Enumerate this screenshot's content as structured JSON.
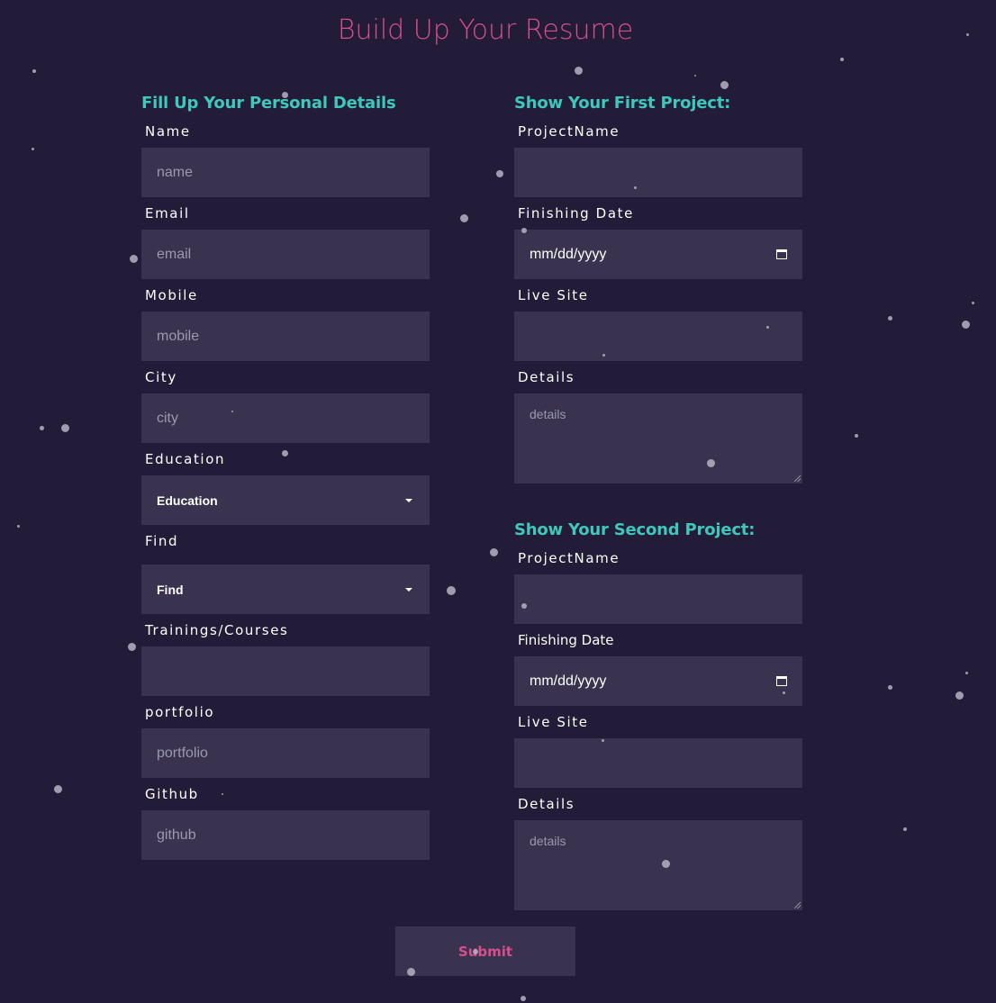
{
  "title": "Build Up Your Resume",
  "personal": {
    "heading": "Fill Up Your Personal Details",
    "name_label": "Name",
    "name_placeholder": "name",
    "email_label": "Email",
    "email_placeholder": "email",
    "mobile_label": "Mobile",
    "mobile_placeholder": "mobile",
    "city_label": "City",
    "city_placeholder": "city",
    "education_label": "Education",
    "education_value": "Education",
    "find_label": "Find",
    "find_value": "Find",
    "trainings_label": "Trainings/Courses",
    "trainings_placeholder": "",
    "portfolio_label": "portfolio",
    "portfolio_placeholder": "portfolio",
    "github_label": "Github",
    "github_placeholder": "github"
  },
  "project1": {
    "heading": "Show Your First Project:",
    "name_label": "ProjectName",
    "date_label": "Finishing Date",
    "date_placeholder": "mm/dd/yyyy",
    "live_label": "Live Site",
    "details_label": "Details",
    "details_placeholder": "details"
  },
  "project2": {
    "heading": "Show Your Second Project:",
    "name_label": "ProjectName",
    "date_label": "Finishing Date",
    "date_placeholder": "mm/dd/yyyy",
    "live_label": "Live Site",
    "details_label": "Details",
    "details_placeholder": "details"
  },
  "submit_label": "Submit",
  "icons": {
    "select_caret": "caret-down-icon",
    "date_picker": "calendar-icon"
  },
  "colors": {
    "background": "#221c39",
    "field": "#393350",
    "accent_pink": "#d64f8c",
    "accent_teal": "#3fc7b9"
  }
}
